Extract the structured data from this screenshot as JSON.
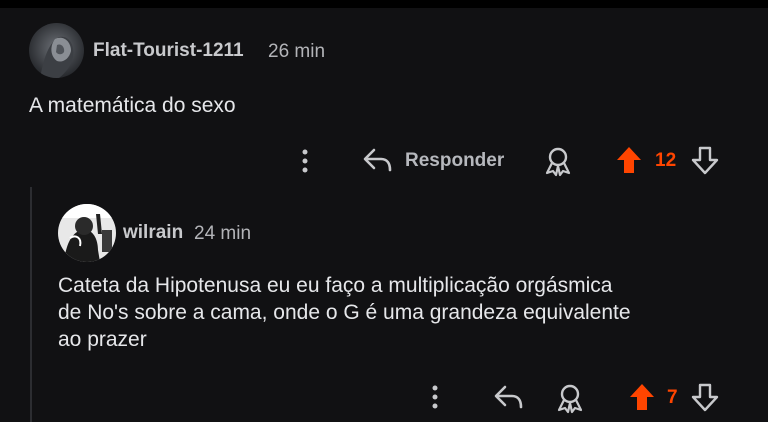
{
  "colors": {
    "background": "#111113",
    "upvote_active": "#ff4500",
    "text_primary": "#e6e7ea",
    "text_secondary": "#b3b4b8"
  },
  "comments": [
    {
      "author": "Flat-Tourist-1211",
      "time": "26 min",
      "body": "A matemática do sexo",
      "actions": {
        "more_icon": "more-vertical-icon",
        "reply_icon": "reply-arrow-icon",
        "reply_label": "Responder",
        "award_icon": "award-icon",
        "upvote_icon": "upvote-arrow-icon",
        "upvoted": true,
        "score": "12",
        "downvote_icon": "downvote-arrow-icon"
      }
    },
    {
      "author": "wilrain",
      "time": "24 min",
      "body": "Cateta da Hipotenusa eu eu faço a multiplicação orgásmica\nde No's sobre a cama, onde o G é uma grandeza equivalente\nao prazer",
      "actions": {
        "more_icon": "more-vertical-icon",
        "reply_icon": "reply-arrow-icon",
        "award_icon": "award-icon",
        "upvote_icon": "upvote-arrow-icon",
        "upvoted": true,
        "score": "7",
        "downvote_icon": "downvote-arrow-icon"
      }
    }
  ]
}
